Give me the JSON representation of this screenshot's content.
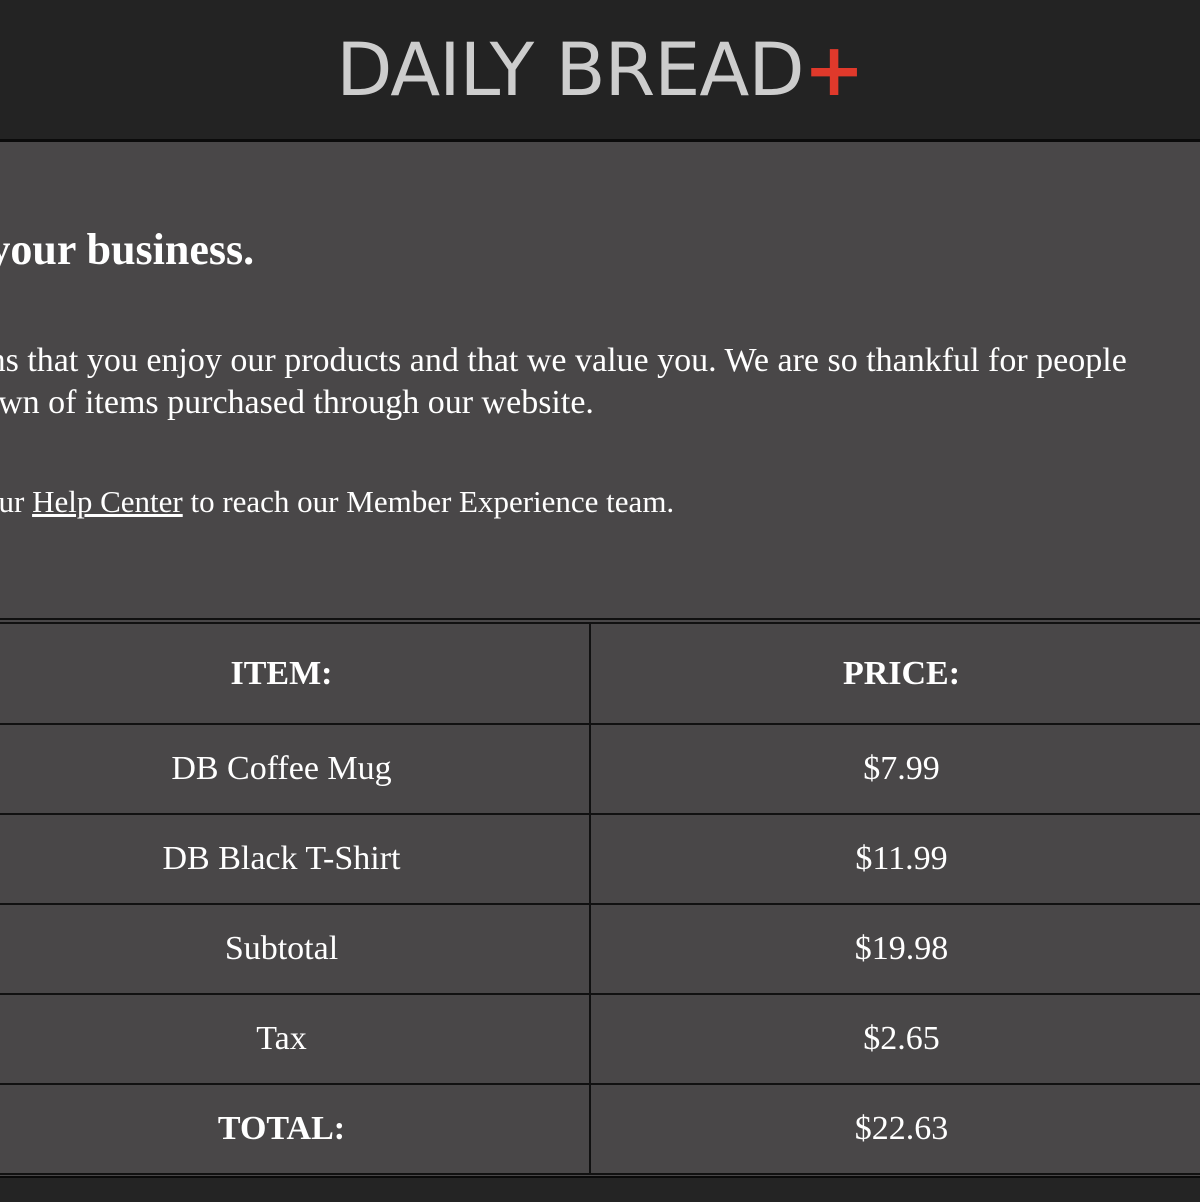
{
  "header": {
    "brand_name": "DAILY BREAD",
    "brand_plus": "+"
  },
  "message": {
    "headline": "for your business.",
    "body_line_1": "means that you enjoy our products and that we value you. We are so thankful for people",
    "body_line_2": "akdown of items purchased through our website.",
    "help_prefix": "our ",
    "help_link_label": "Help Center",
    "help_suffix": " to reach our Member Experience team."
  },
  "receipt": {
    "headers": {
      "item": "ITEM:",
      "price": "PRICE:"
    },
    "rows": [
      {
        "item": "DB Coffee Mug",
        "price": "$7.99"
      },
      {
        "item": "DB Black T-Shirt",
        "price": "$11.99"
      },
      {
        "item": "Subtotal",
        "price": "$19.98"
      },
      {
        "item": "Tax",
        "price": "$2.65"
      },
      {
        "item": "TOTAL:",
        "price": "$22.63"
      }
    ]
  },
  "colors": {
    "header_bg": "#232323",
    "content_bg": "#494748",
    "brand_text": "#cdcdcd",
    "brand_accent": "#e0392b",
    "text": "#ffffff"
  }
}
